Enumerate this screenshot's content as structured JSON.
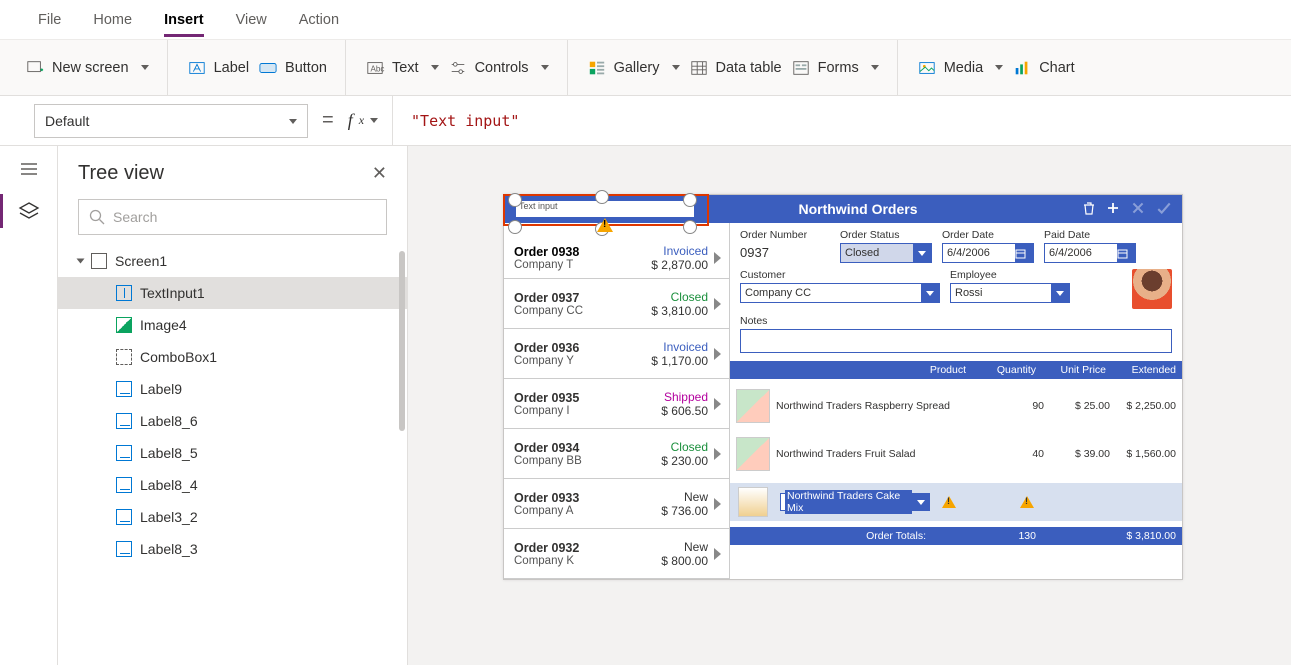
{
  "menu": {
    "file": "File",
    "home": "Home",
    "insert": "Insert",
    "view": "View",
    "action": "Action"
  },
  "ribbon": {
    "newscreen": "New screen",
    "label": "Label",
    "button": "Button",
    "text": "Text",
    "controls": "Controls",
    "gallery": "Gallery",
    "datatable": "Data table",
    "forms": "Forms",
    "media": "Media",
    "chart": "Chart"
  },
  "prop": {
    "selected": "Default",
    "formula": "\"Text input\""
  },
  "tree": {
    "title": "Tree view",
    "search_ph": "Search",
    "root": "Screen1",
    "items": [
      "TextInput1",
      "Image4",
      "ComboBox1",
      "Label9",
      "Label8_6",
      "Label8_5",
      "Label8_4",
      "Label3_2",
      "Label8_3"
    ]
  },
  "selection": {
    "placeholder": "Text input"
  },
  "app": {
    "title": "Northwind Orders",
    "orders": [
      {
        "id": "Order 0938",
        "co": "Company T",
        "status": "Invoiced",
        "amt": "$ 2,870.00"
      },
      {
        "id": "Order 0937",
        "co": "Company CC",
        "status": "Closed",
        "amt": "$ 3,810.00"
      },
      {
        "id": "Order 0936",
        "co": "Company Y",
        "status": "Invoiced",
        "amt": "$ 1,170.00"
      },
      {
        "id": "Order 0935",
        "co": "Company I",
        "status": "Shipped",
        "amt": "$ 606.50"
      },
      {
        "id": "Order 0934",
        "co": "Company BB",
        "status": "Closed",
        "amt": "$ 230.00"
      },
      {
        "id": "Order 0933",
        "co": "Company A",
        "status": "New",
        "amt": "$ 736.00"
      },
      {
        "id": "Order 0932",
        "co": "Company K",
        "status": "New",
        "amt": "$ 800.00"
      }
    ],
    "form": {
      "on_label": "Order Number",
      "on": "0937",
      "os_label": "Order Status",
      "os": "Closed",
      "od_label": "Order Date",
      "od": "6/4/2006",
      "pd_label": "Paid Date",
      "pd": "6/4/2006",
      "cust_label": "Customer",
      "cust": "Company CC",
      "emp_label": "Employee",
      "emp": "Rossi",
      "notes_label": "Notes"
    },
    "grid": {
      "h_product": "Product",
      "h_qty": "Quantity",
      "h_unit": "Unit Price",
      "h_ext": "Extended",
      "rows": [
        {
          "name": "Northwind Traders Raspberry Spread",
          "qty": "90",
          "unit": "$ 25.00",
          "ext": "$ 2,250.00"
        },
        {
          "name": "Northwind Traders Fruit Salad",
          "qty": "40",
          "unit": "$ 39.00",
          "ext": "$ 1,560.00"
        }
      ],
      "newprod": "Northwind Traders Cake Mix",
      "tot_label": "Order Totals:",
      "tot_qty": "130",
      "tot_ext": "$ 3,810.00"
    }
  }
}
